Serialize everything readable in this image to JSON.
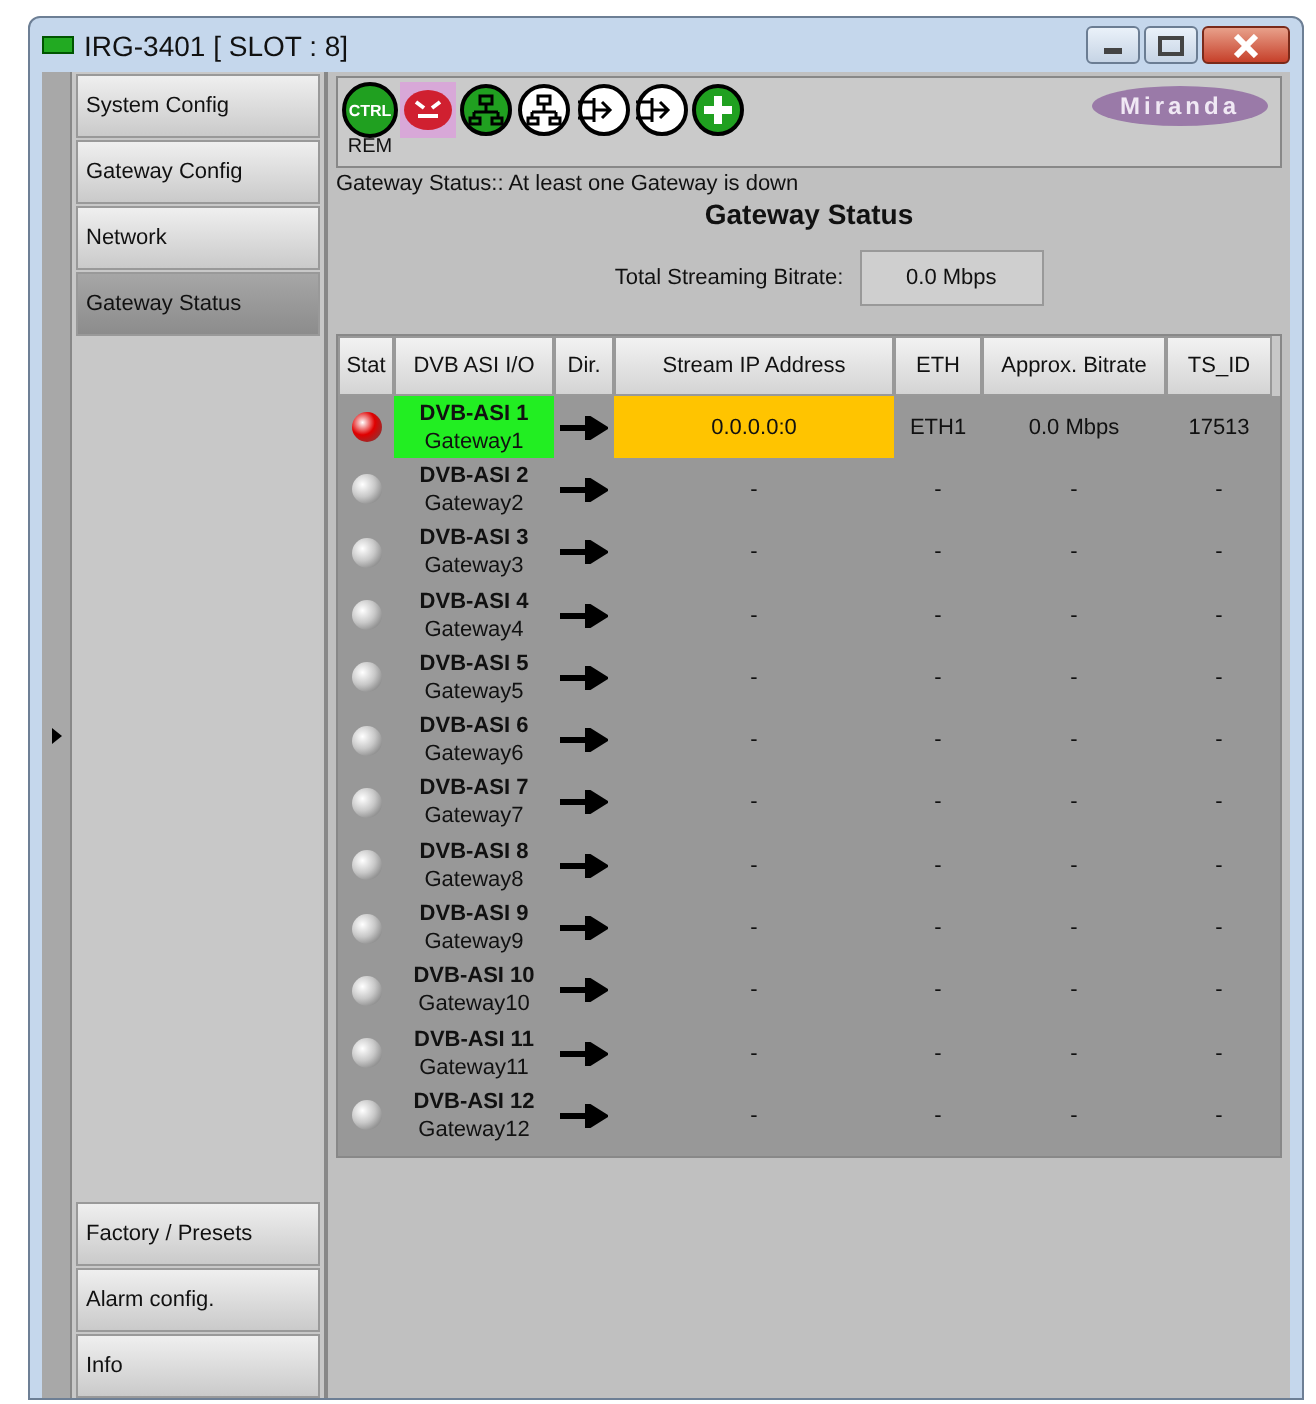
{
  "window": {
    "title": "IRG-3401 [ SLOT : 8]"
  },
  "sidebar": {
    "items": [
      {
        "label": "System Config",
        "selected": false
      },
      {
        "label": "Gateway Config",
        "selected": false
      },
      {
        "label": "Network",
        "selected": false
      },
      {
        "label": "Gateway Status",
        "selected": true
      }
    ],
    "bottom_items": [
      {
        "label": "Factory / Presets",
        "selected": false
      },
      {
        "label": "Alarm config.",
        "selected": false
      },
      {
        "label": "Info",
        "selected": false
      }
    ]
  },
  "toolbar": {
    "icons": [
      {
        "kind": "ctrl",
        "label": "CTRL",
        "caption": "REM",
        "alarm": false
      },
      {
        "kind": "face",
        "alarm": true
      },
      {
        "kind": "network",
        "alarm": false
      },
      {
        "kind": "network",
        "alarm": true
      },
      {
        "kind": "input",
        "alarm": true
      },
      {
        "kind": "input",
        "alarm": true
      },
      {
        "kind": "plus",
        "alarm": false
      }
    ],
    "logo": "Miranda"
  },
  "status_message": "Gateway Status:: At least one Gateway is down",
  "heading": "Gateway Status",
  "total": {
    "label": "Total Streaming Bitrate:",
    "value": "0.0 Mbps"
  },
  "table": {
    "columns": [
      "Stat",
      "DVB ASI I/O",
      "Dir.",
      "Stream IP Address",
      "ETH",
      "Approx. Bitrate",
      "TS_ID"
    ],
    "rows": [
      {
        "alarm": true,
        "active": true,
        "asi": "DVB-ASI 1",
        "gateway": "Gateway1",
        "ip": "0.0.0.0:0",
        "eth": "ETH1",
        "bitrate": "0.0 Mbps",
        "ts_id": "17513"
      },
      {
        "alarm": false,
        "active": false,
        "asi": "DVB-ASI 2",
        "gateway": "Gateway2",
        "ip": "-",
        "eth": "-",
        "bitrate": "-",
        "ts_id": "-"
      },
      {
        "alarm": false,
        "active": false,
        "asi": "DVB-ASI 3",
        "gateway": "Gateway3",
        "ip": "-",
        "eth": "-",
        "bitrate": "-",
        "ts_id": "-"
      },
      {
        "alarm": false,
        "active": false,
        "asi": "DVB-ASI 4",
        "gateway": "Gateway4",
        "ip": "-",
        "eth": "-",
        "bitrate": "-",
        "ts_id": "-"
      },
      {
        "alarm": false,
        "active": false,
        "asi": "DVB-ASI 5",
        "gateway": "Gateway5",
        "ip": "-",
        "eth": "-",
        "bitrate": "-",
        "ts_id": "-"
      },
      {
        "alarm": false,
        "active": false,
        "asi": "DVB-ASI 6",
        "gateway": "Gateway6",
        "ip": "-",
        "eth": "-",
        "bitrate": "-",
        "ts_id": "-"
      },
      {
        "alarm": false,
        "active": false,
        "asi": "DVB-ASI 7",
        "gateway": "Gateway7",
        "ip": "-",
        "eth": "-",
        "bitrate": "-",
        "ts_id": "-"
      },
      {
        "alarm": false,
        "active": false,
        "asi": "DVB-ASI 8",
        "gateway": "Gateway8",
        "ip": "-",
        "eth": "-",
        "bitrate": "-",
        "ts_id": "-"
      },
      {
        "alarm": false,
        "active": false,
        "asi": "DVB-ASI 9",
        "gateway": "Gateway9",
        "ip": "-",
        "eth": "-",
        "bitrate": "-",
        "ts_id": "-"
      },
      {
        "alarm": false,
        "active": false,
        "asi": "DVB-ASI 10",
        "gateway": "Gateway10",
        "ip": "-",
        "eth": "-",
        "bitrate": "-",
        "ts_id": "-"
      },
      {
        "alarm": false,
        "active": false,
        "asi": "DVB-ASI 11",
        "gateway": "Gateway11",
        "ip": "-",
        "eth": "-",
        "bitrate": "-",
        "ts_id": "-"
      },
      {
        "alarm": false,
        "active": false,
        "asi": "DVB-ASI 12",
        "gateway": "Gateway12",
        "ip": "-",
        "eth": "-",
        "bitrate": "-",
        "ts_id": "-"
      }
    ]
  }
}
